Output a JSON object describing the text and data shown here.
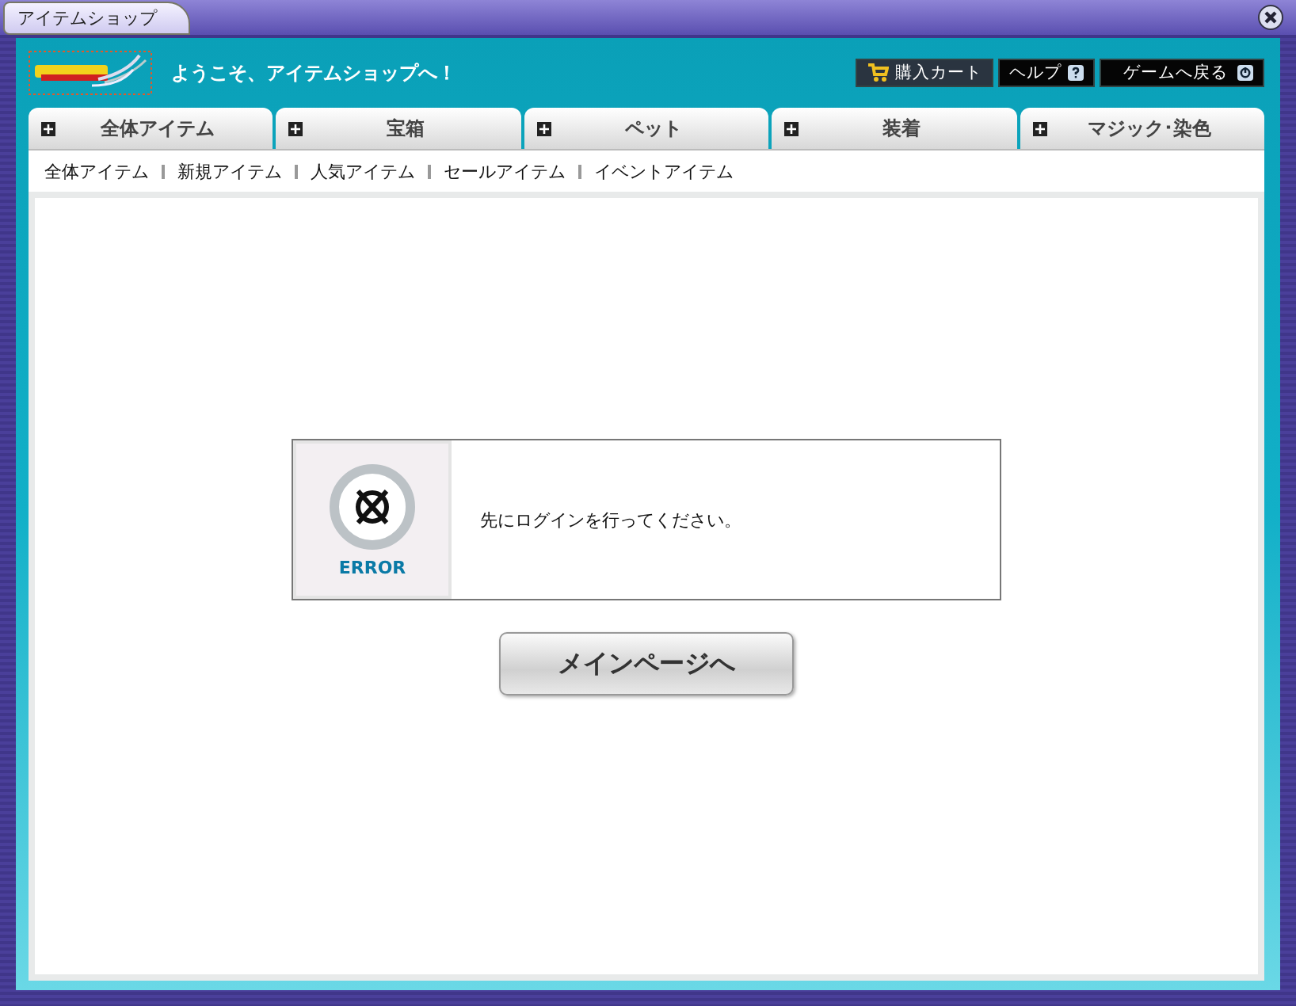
{
  "window": {
    "title": "アイテムショップ"
  },
  "header": {
    "welcome": "ようこそ、アイテムショップへ！",
    "buttons": [
      {
        "kind": "cart",
        "label": "購入カート"
      },
      {
        "kind": "help",
        "label": "ヘルプ"
      },
      {
        "kind": "back",
        "label": "ゲームへ戻る"
      }
    ]
  },
  "tabs": [
    {
      "label": "全体アイテム"
    },
    {
      "label": "宝箱"
    },
    {
      "label": "ペット"
    },
    {
      "label": "装着"
    },
    {
      "label": "マジック･染色"
    }
  ],
  "submenu": [
    "全体アイテム",
    "新規アイテム",
    "人気アイテム",
    "セールアイテム",
    "イベントアイテム"
  ],
  "error": {
    "label": "ERROR",
    "message": "先にログインを行ってください。"
  },
  "main_button": "メインページへ"
}
